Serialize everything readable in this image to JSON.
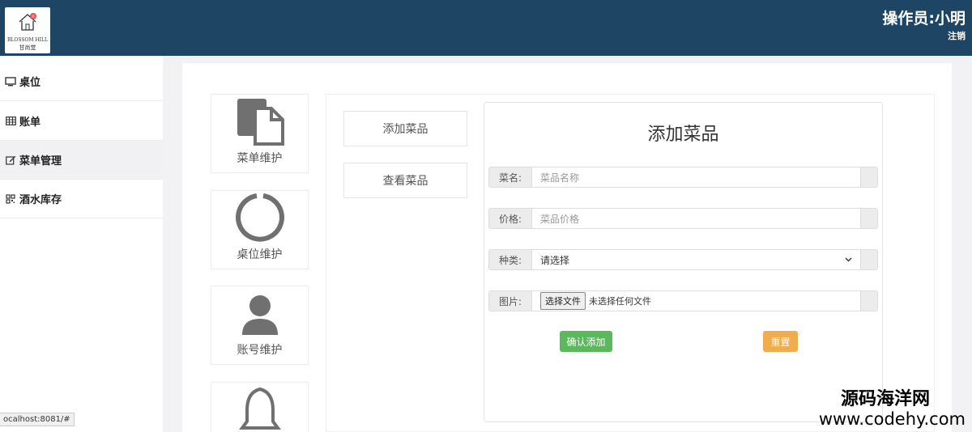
{
  "header": {
    "logo_en": "BLOSSOM HILL",
    "logo_cn": "甘尚堂",
    "operator": "操作员:小明",
    "logout": "注销"
  },
  "sidebar": {
    "items": [
      {
        "label": "桌位",
        "icon": "monitor-icon"
      },
      {
        "label": "账单",
        "icon": "table-icon"
      },
      {
        "label": "菜单管理",
        "icon": "edit-icon",
        "active": true
      },
      {
        "label": "酒水库存",
        "icon": "grid-icon"
      }
    ]
  },
  "status_url": "ocalhost:8081/#",
  "tiles": [
    {
      "label": "菜单维护",
      "icon": "copy-icon"
    },
    {
      "label": "桌位维护",
      "icon": "ring-icon"
    },
    {
      "label": "账号维护",
      "icon": "user-icon"
    },
    {
      "label": "",
      "icon": "bell-icon"
    }
  ],
  "sub_buttons": {
    "add": "添加菜品",
    "view": "查看菜品"
  },
  "form": {
    "title": "添加菜品",
    "name_label": "菜名:",
    "name_placeholder": "菜品名称",
    "price_label": "价格:",
    "price_placeholder": "菜品价格",
    "type_label": "种类:",
    "type_value": "请选择",
    "image_label": "图片:",
    "file_button": "选择文件",
    "file_status": "未选择任何文件",
    "submit": "确认添加",
    "reset": "重置"
  },
  "watermark": {
    "cn": "源码海洋网",
    "en": "www.codehy.com"
  },
  "colors": {
    "header": "#1e4664",
    "submit": "#5cb85c",
    "reset": "#f0ad4e"
  }
}
